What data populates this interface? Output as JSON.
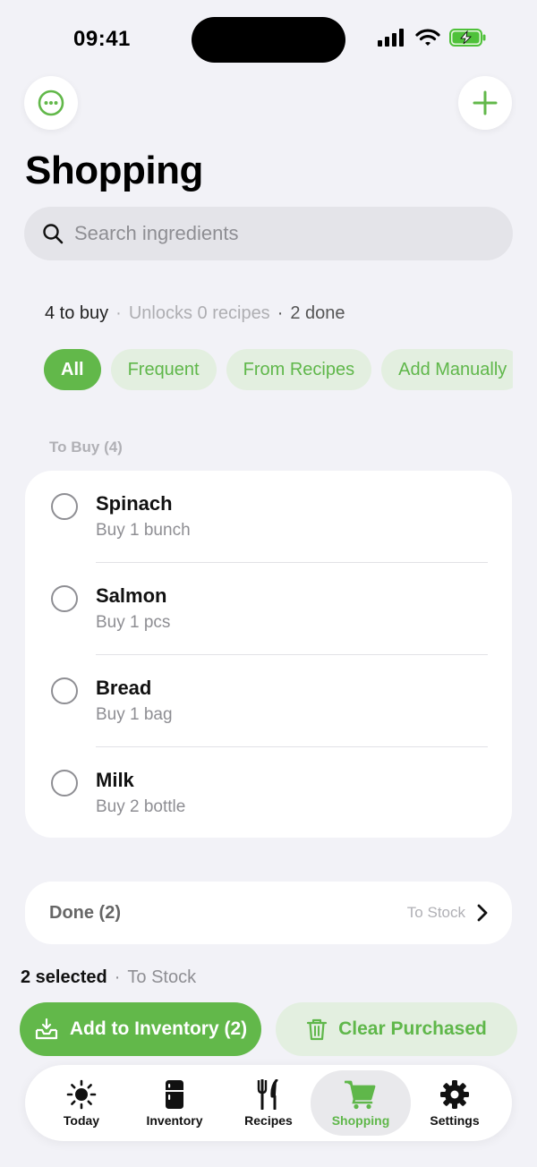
{
  "status_bar": {
    "time": "09:41"
  },
  "header": {
    "title": "Shopping"
  },
  "search": {
    "placeholder": "Search ingredients"
  },
  "summary": {
    "to_buy": "4 to buy",
    "unlocks": "Unlocks 0 recipes",
    "done": "2 done",
    "separator": "·"
  },
  "filters": [
    {
      "label": "All",
      "active": true
    },
    {
      "label": "Frequent",
      "active": false
    },
    {
      "label": "From Recipes",
      "active": false
    },
    {
      "label": "Add Manually",
      "active": false
    }
  ],
  "to_buy_section": {
    "label": "To Buy (4)",
    "items": [
      {
        "name": "Spinach",
        "qty": "Buy 1 bunch"
      },
      {
        "name": "Salmon",
        "qty": "Buy 1 pcs"
      },
      {
        "name": "Bread",
        "qty": "Buy 1 bag"
      },
      {
        "name": "Milk",
        "qty": "Buy 2 bottle"
      }
    ]
  },
  "done_section": {
    "label": "Done (2)",
    "hint": "To Stock"
  },
  "selection": {
    "count": "2 selected",
    "separator": "·",
    "target": "To Stock"
  },
  "actions": {
    "add_label": "Add to Inventory (2)",
    "clear_label": "Clear Purchased"
  },
  "tabs": [
    {
      "label": "Today",
      "icon": "sun-icon",
      "active": false
    },
    {
      "label": "Inventory",
      "icon": "fridge-icon",
      "active": false
    },
    {
      "label": "Recipes",
      "icon": "fork-knife-icon",
      "active": false
    },
    {
      "label": "Shopping",
      "icon": "cart-icon",
      "active": true
    },
    {
      "label": "Settings",
      "icon": "gear-icon",
      "active": false
    }
  ],
  "colors": {
    "accent": "#62b84a",
    "accent_soft": "#e3efe0",
    "background": "#f2f2f7"
  }
}
